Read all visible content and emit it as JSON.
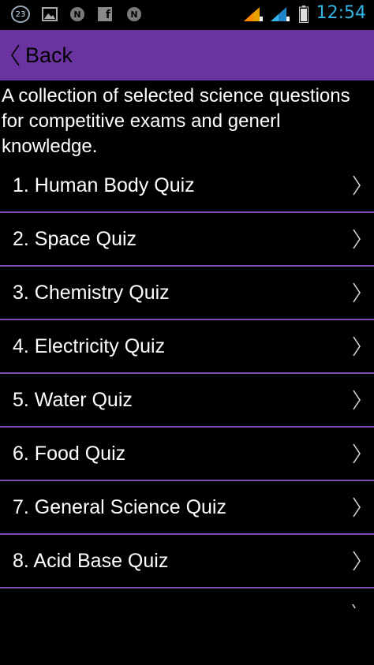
{
  "status_bar": {
    "notification_count": "23",
    "notif_n1": "N",
    "notif_fb": "f",
    "notif_n2": "N",
    "time": "12:54",
    "icons": [
      "image-icon",
      "signal-icon",
      "signal-icon",
      "battery-icon"
    ]
  },
  "action_bar": {
    "back_label": "Back",
    "color": "#6a33a0"
  },
  "description": "A collection of selected science questions for competitive exams and generl knowledge.",
  "quizzes": [
    {
      "label": "1. Human Body Quiz"
    },
    {
      "label": "2. Space Quiz"
    },
    {
      "label": "3. Chemistry Quiz"
    },
    {
      "label": "4. Electricity Quiz"
    },
    {
      "label": "5. Water Quiz"
    },
    {
      "label": "6. Food Quiz"
    },
    {
      "label": "7. General Science Quiz"
    },
    {
      "label": "8. Acid Base Quiz"
    }
  ],
  "colors": {
    "accent": "#6a33a0",
    "divider": "#7d4db8",
    "clock": "#33b5e5",
    "background": "#000000"
  }
}
